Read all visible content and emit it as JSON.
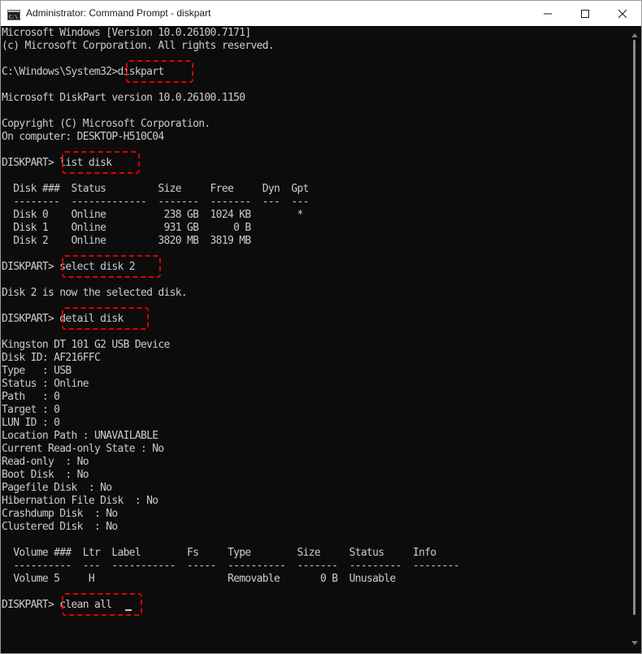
{
  "window": {
    "title": "Administrator: Command Prompt - diskpart",
    "icon_name": "console-icon",
    "accent": "#e00000"
  },
  "terminal": {
    "lines": [
      "Microsoft Windows [Version 10.0.26100.7171]",
      "(c) Microsoft Corporation. All rights reserved.",
      "",
      "C:\\Windows\\System32>diskpart",
      "",
      "Microsoft DiskPart version 10.0.26100.1150",
      "",
      "Copyright (C) Microsoft Corporation.",
      "On computer: DESKTOP-H510C04",
      "",
      "DISKPART> list disk",
      "",
      "  Disk ###  Status         Size     Free     Dyn  Gpt",
      "  --------  -------------  -------  -------  ---  ---",
      "  Disk 0    Online          238 GB  1024 KB        *",
      "  Disk 1    Online          931 GB      0 B",
      "  Disk 2    Online         3820 MB  3819 MB",
      "",
      "DISKPART> select disk 2",
      "",
      "Disk 2 is now the selected disk.",
      "",
      "DISKPART> detail disk",
      "",
      "Kingston DT 101 G2 USB Device",
      "Disk ID: AF216FFC",
      "Type   : USB",
      "Status : Online",
      "Path   : 0",
      "Target : 0",
      "LUN ID : 0",
      "Location Path : UNAVAILABLE",
      "Current Read-only State : No",
      "Read-only  : No",
      "Boot Disk  : No",
      "Pagefile Disk  : No",
      "Hibernation File Disk  : No",
      "Crashdump Disk  : No",
      "Clustered Disk  : No",
      "",
      "  Volume ###  Ltr  Label        Fs     Type        Size     Status     Info",
      "  ----------  ---  -----------  -----  ----------  -------  ---------  --------",
      "  Volume 5     H                       Removable       0 B  Unusable",
      "",
      "DISKPART> clean all"
    ],
    "highlighted_commands": [
      "diskpart",
      "list disk",
      "select disk 2",
      "detail disk",
      "clean all"
    ]
  }
}
